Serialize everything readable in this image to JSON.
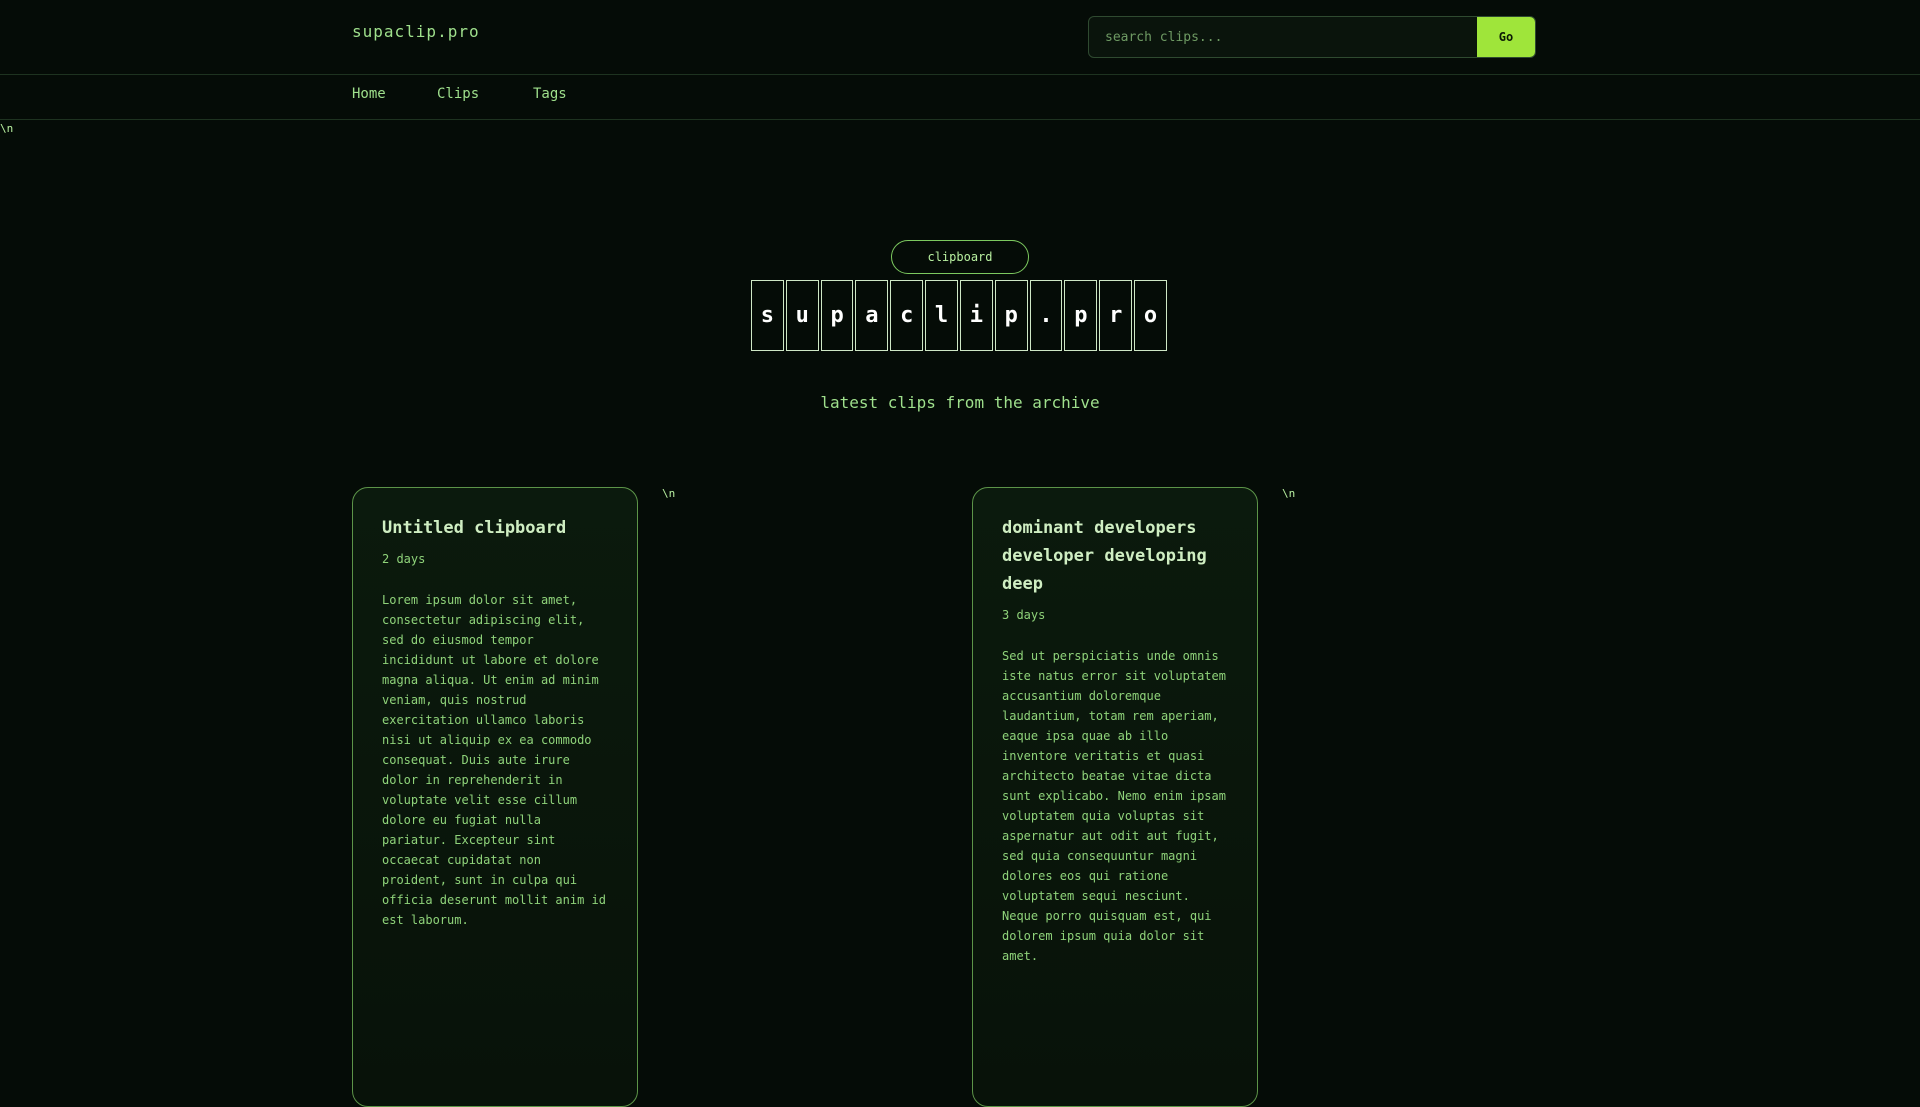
{
  "header": {
    "brand": "supaclip.pro",
    "search_placeholder": "search clips...",
    "search_button": "Go"
  },
  "nav": {
    "items": [
      "Home",
      "Clips",
      "Tags"
    ]
  },
  "skip_marker": "\\n",
  "hero": {
    "badge": "clipboard",
    "title_chars": [
      "s",
      "u",
      "p",
      "a",
      "c",
      "l",
      "i",
      "p",
      ".",
      "p",
      "r",
      "o"
    ],
    "subtitle": "latest clips from the archive"
  },
  "cards": [
    {
      "title": "Untitled clipboard",
      "meta": "2 days",
      "body": "Lorem ipsum dolor sit amet, consectetur adipiscing elit, sed do eiusmod tempor incididunt ut labore et dolore magna aliqua. Ut enim ad minim veniam, quis nostrud exercitation ullamco laboris nisi ut aliquip ex ea commodo consequat. Duis aute irure dolor in reprehenderit in voluptate velit esse cillum dolore eu fugiat nulla pariatur. Excepteur sint occaecat cupidatat non proident, sunt in culpa qui officia deserunt mollit anim id est laborum.",
      "marker": "\\n"
    },
    {
      "title": "dominant developers developer developing deep",
      "meta": "3 days",
      "body": "Sed ut perspiciatis unde omnis iste natus error sit voluptatem accusantium doloremque laudantium, totam rem aperiam, eaque ipsa quae ab illo inventore veritatis et quasi architecto beatae vitae dicta sunt explicabo. Nemo enim ipsam voluptatem quia voluptas sit aspernatur aut odit aut fugit, sed quia consequuntur magni dolores eos qui ratione voluptatem sequi nesciunt. Neque porro quisquam est, qui dolorem ipsum quia dolor sit amet.",
      "marker": "\\n"
    }
  ]
}
